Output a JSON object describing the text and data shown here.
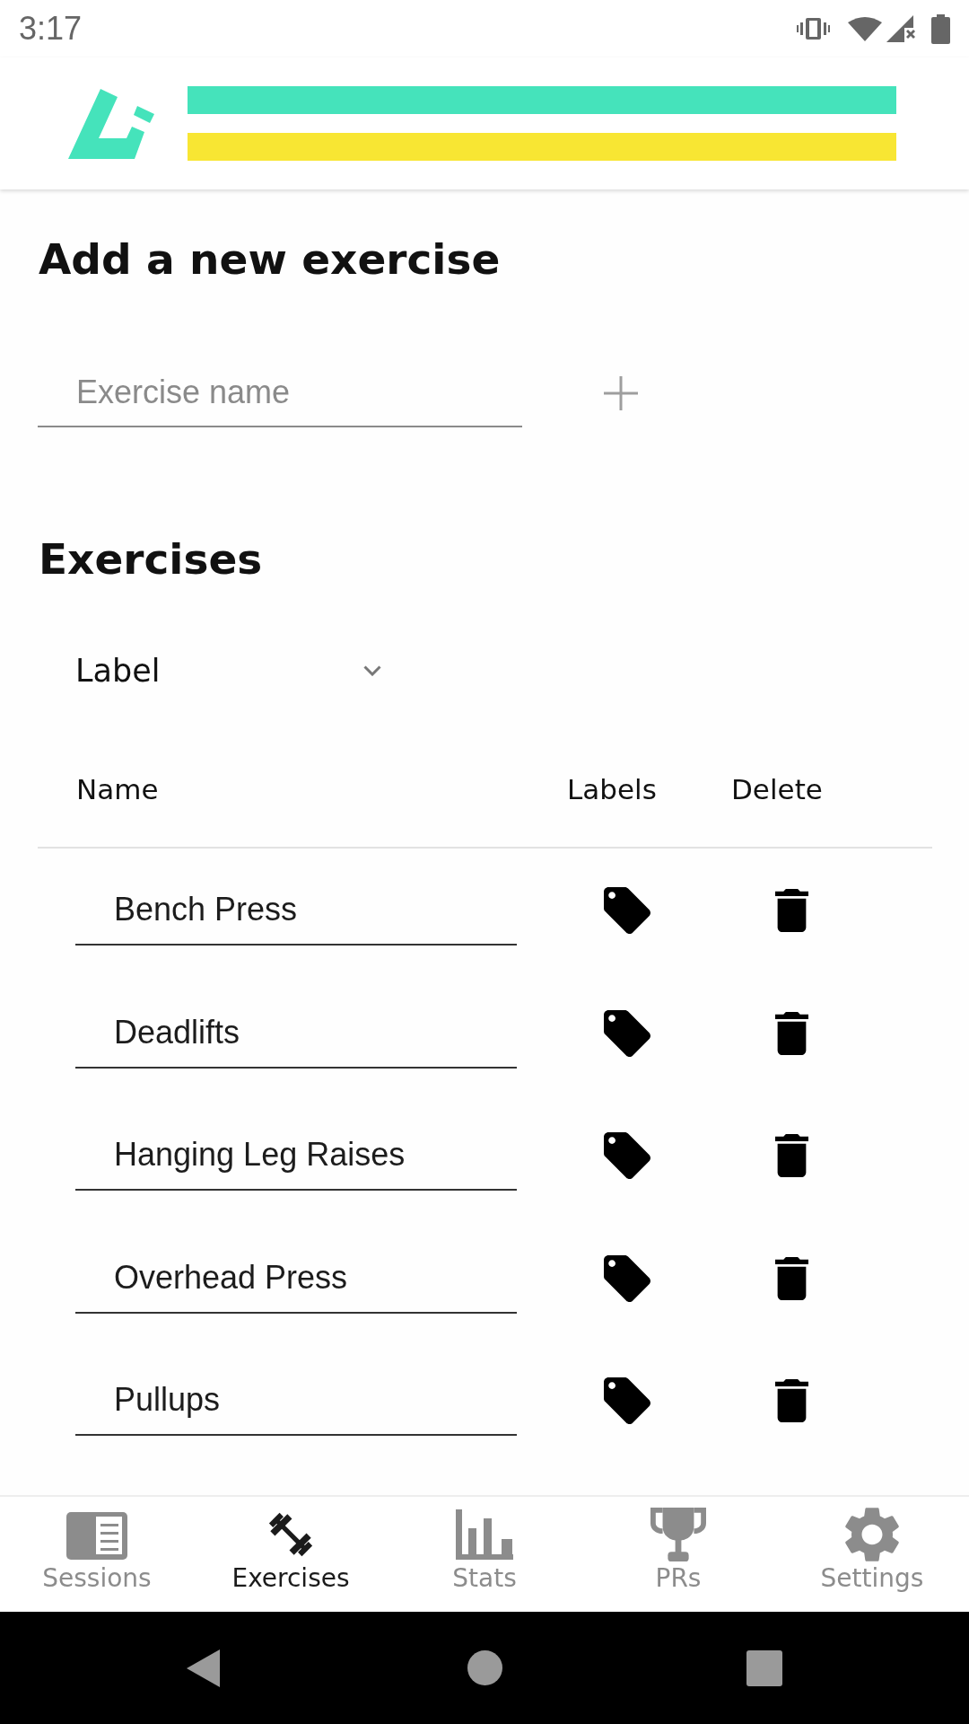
{
  "status_bar": {
    "time": "3:17"
  },
  "add_exercise": {
    "title": "Add a new exercise",
    "name_field": {
      "placeholder": "Exercise name"
    }
  },
  "exercises": {
    "title": "Exercises",
    "label_filter": {
      "value": "Label"
    },
    "table": {
      "columns": [
        "Name",
        "Labels",
        "Delete"
      ],
      "rows": [
        {
          "name": "Bench Press"
        },
        {
          "name": "Deadlifts"
        },
        {
          "name": "Hanging Leg Raises"
        },
        {
          "name": "Overhead Press"
        },
        {
          "name": "Pullups"
        }
      ]
    }
  },
  "bottom_nav": [
    {
      "label": "Sessions",
      "selected": false
    },
    {
      "label": "Exercises",
      "selected": true
    },
    {
      "label": "Stats",
      "selected": false
    },
    {
      "label": "PRs",
      "selected": false
    },
    {
      "label": "Settings",
      "selected": false
    }
  ]
}
